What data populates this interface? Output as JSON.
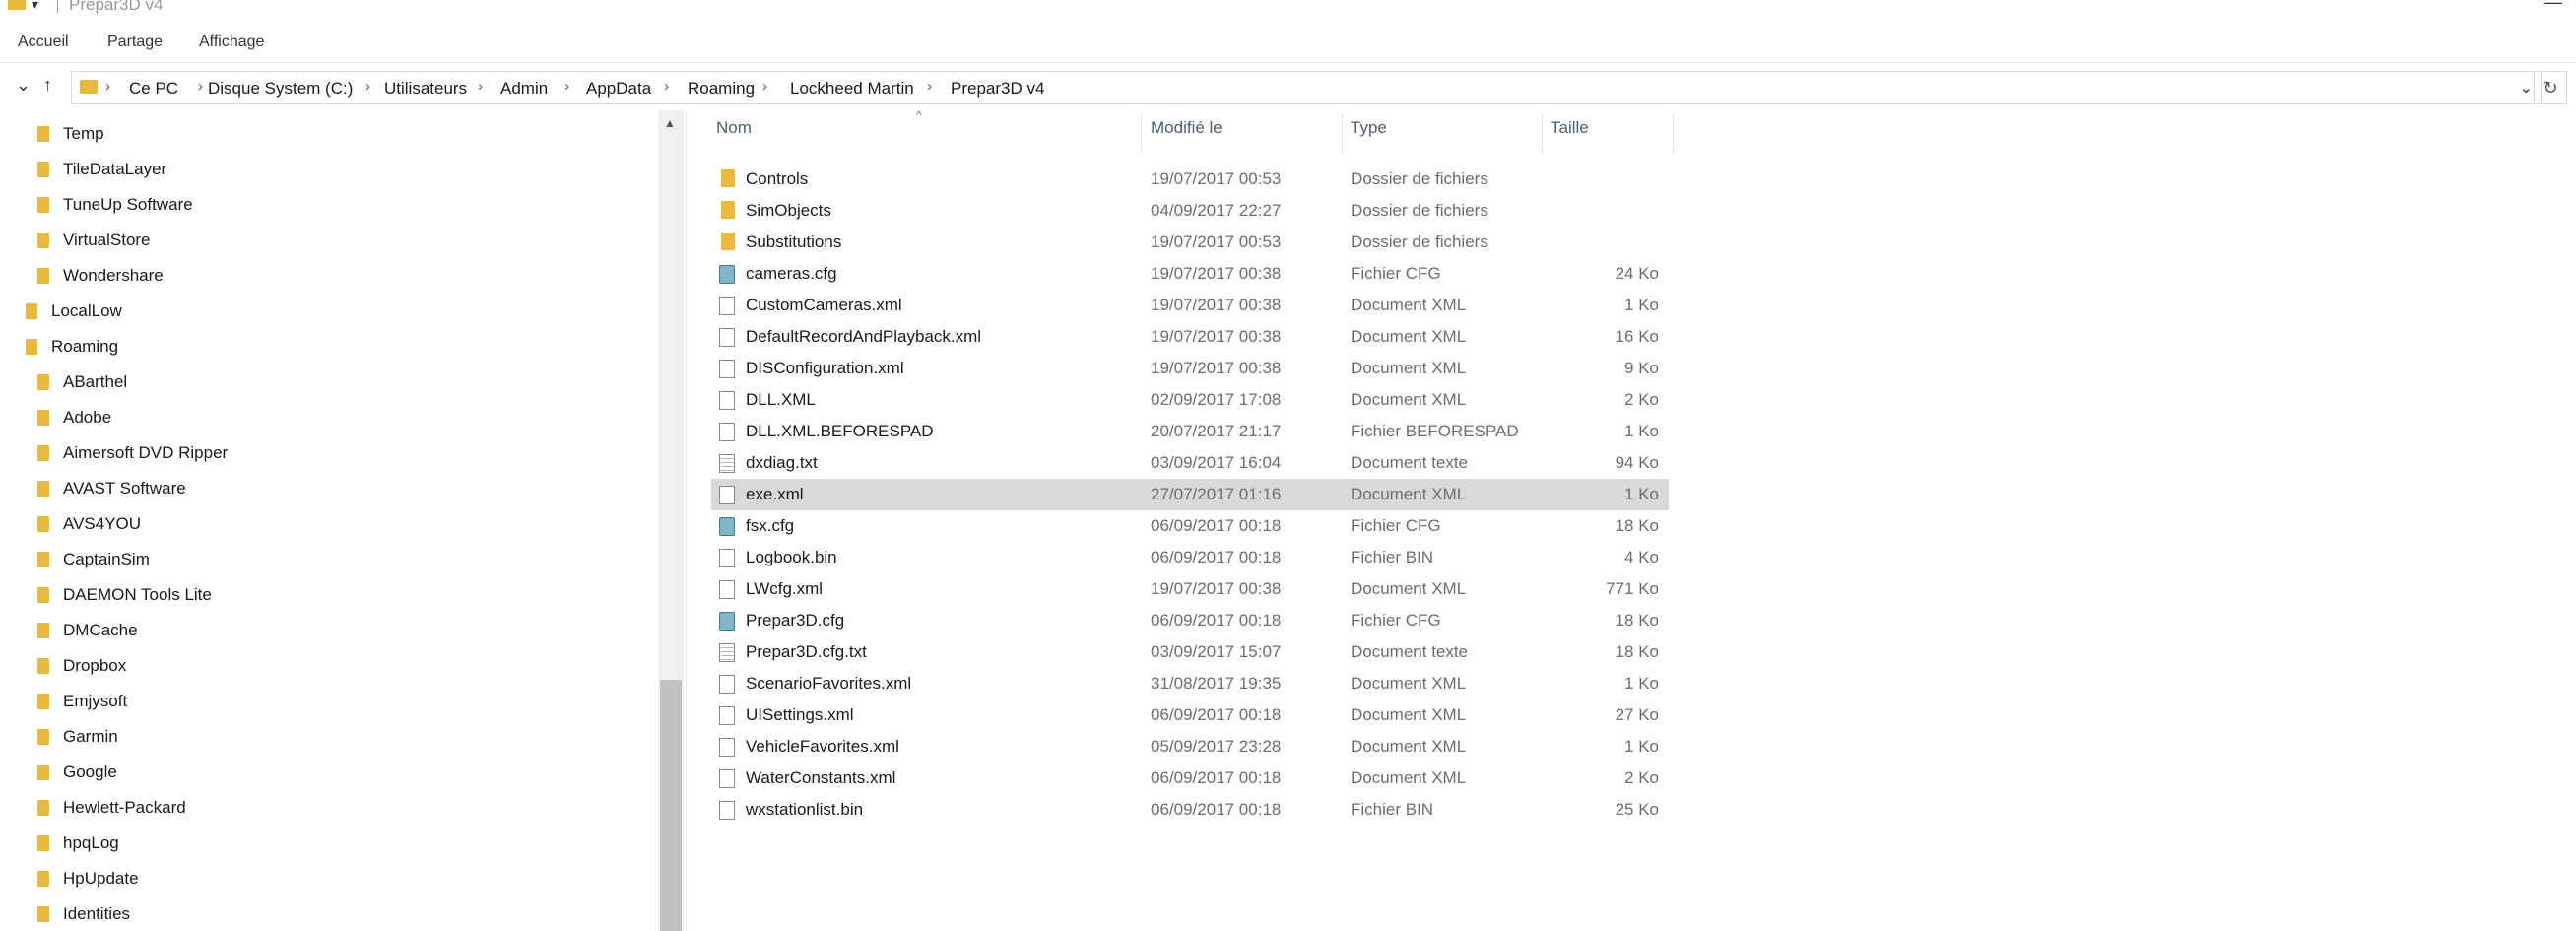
{
  "window": {
    "title": "Prepar3D v4",
    "quick_access": "▾",
    "minimize": "—"
  },
  "ribbon": {
    "tabs": [
      "Accueil",
      "Partage",
      "Affichage"
    ]
  },
  "nav": {
    "expand": "⌄",
    "up": "↑",
    "dropdown": "⌄",
    "refresh": "↻"
  },
  "breadcrumb": [
    "Ce PC",
    "Disque System (C:)",
    "Utilisateurs",
    "Admin",
    "AppData",
    "Roaming",
    "Lockheed Martin",
    "Prepar3D v4"
  ],
  "breadcrumb_sep": "›",
  "tree": [
    {
      "label": "Temp"
    },
    {
      "label": "TileDataLayer"
    },
    {
      "label": "TuneUp Software"
    },
    {
      "label": "VirtualStore"
    },
    {
      "label": "Wondershare"
    },
    {
      "label": "LocalLow"
    },
    {
      "label": "Roaming"
    },
    {
      "label": "ABarthel"
    },
    {
      "label": "Adobe"
    },
    {
      "label": "Aimersoft DVD Ripper"
    },
    {
      "label": "AVAST Software"
    },
    {
      "label": "AVS4YOU"
    },
    {
      "label": "CaptainSim"
    },
    {
      "label": "DAEMON Tools Lite"
    },
    {
      "label": "DMCache"
    },
    {
      "label": "Dropbox"
    },
    {
      "label": "Emjysoft"
    },
    {
      "label": "Garmin"
    },
    {
      "label": "Google"
    },
    {
      "label": "Hewlett-Packard"
    },
    {
      "label": "hpqLog"
    },
    {
      "label": "HpUpdate"
    },
    {
      "label": "Identities"
    }
  ],
  "columns": {
    "name": "Nom",
    "modified": "Modifié le",
    "type": "Type",
    "size": "Taille",
    "sort_indicator": "^"
  },
  "files": [
    {
      "name": "Controls",
      "date": "19/07/2017 00:53",
      "type": "Dossier de fichiers",
      "size": "",
      "icon": "folder-icon"
    },
    {
      "name": "SimObjects",
      "date": "04/09/2017 22:27",
      "type": "Dossier de fichiers",
      "size": "",
      "icon": "folder-icon"
    },
    {
      "name": "Substitutions",
      "date": "19/07/2017 00:53",
      "type": "Dossier de fichiers",
      "size": "",
      "icon": "folder-icon"
    },
    {
      "name": "cameras.cfg",
      "date": "19/07/2017 00:38",
      "type": "Fichier CFG",
      "size": "24 Ko",
      "icon": "cfg-file-icon"
    },
    {
      "name": "CustomCameras.xml",
      "date": "19/07/2017 00:38",
      "type": "Document XML",
      "size": "1 Ko",
      "icon": "file-icon"
    },
    {
      "name": "DefaultRecordAndPlayback.xml",
      "date": "19/07/2017 00:38",
      "type": "Document XML",
      "size": "16 Ko",
      "icon": "file-icon"
    },
    {
      "name": "DISConfiguration.xml",
      "date": "19/07/2017 00:38",
      "type": "Document XML",
      "size": "9 Ko",
      "icon": "file-icon"
    },
    {
      "name": "DLL.XML",
      "date": "02/09/2017 17:08",
      "type": "Document XML",
      "size": "2 Ko",
      "icon": "file-icon"
    },
    {
      "name": "DLL.XML.BEFORESPAD",
      "date": "20/07/2017 21:17",
      "type": "Fichier BEFORESPAD",
      "size": "1 Ko",
      "icon": "file-icon"
    },
    {
      "name": "dxdiag.txt",
      "date": "03/09/2017 16:04",
      "type": "Document texte",
      "size": "94 Ko",
      "icon": "text-file-icon"
    },
    {
      "name": "exe.xml",
      "date": "27/07/2017 01:16",
      "type": "Document XML",
      "size": "1 Ko",
      "icon": "file-icon",
      "selected": true
    },
    {
      "name": "fsx.cfg",
      "date": "06/09/2017 00:18",
      "type": "Fichier CFG",
      "size": "18 Ko",
      "icon": "cfg-file-icon"
    },
    {
      "name": "Logbook.bin",
      "date": "06/09/2017 00:18",
      "type": "Fichier BIN",
      "size": "4 Ko",
      "icon": "file-icon"
    },
    {
      "name": "LWcfg.xml",
      "date": "19/07/2017 00:38",
      "type": "Document XML",
      "size": "771 Ko",
      "icon": "file-icon"
    },
    {
      "name": "Prepar3D.cfg",
      "date": "06/09/2017 00:18",
      "type": "Fichier CFG",
      "size": "18 Ko",
      "icon": "cfg-file-icon"
    },
    {
      "name": "Prepar3D.cfg.txt",
      "date": "03/09/2017 15:07",
      "type": "Document texte",
      "size": "18 Ko",
      "icon": "text-file-icon"
    },
    {
      "name": "ScenarioFavorites.xml",
      "date": "31/08/2017 19:35",
      "type": "Document XML",
      "size": "1 Ko",
      "icon": "file-icon"
    },
    {
      "name": "UISettings.xml",
      "date": "06/09/2017 00:18",
      "type": "Document XML",
      "size": "27 Ko",
      "icon": "file-icon"
    },
    {
      "name": "VehicleFavorites.xml",
      "date": "05/09/2017 23:28",
      "type": "Document XML",
      "size": "1 Ko",
      "icon": "file-icon"
    },
    {
      "name": "WaterConstants.xml",
      "date": "06/09/2017 00:18",
      "type": "Document XML",
      "size": "2 Ko",
      "icon": "file-icon"
    },
    {
      "name": "wxstationlist.bin",
      "date": "06/09/2017 00:18",
      "type": "Fichier BIN",
      "size": "25 Ko",
      "icon": "file-icon"
    }
  ],
  "colors": {
    "folder": "#e9b93b",
    "selected_row": "#d9d9d9",
    "header_text": "#4c607a"
  }
}
